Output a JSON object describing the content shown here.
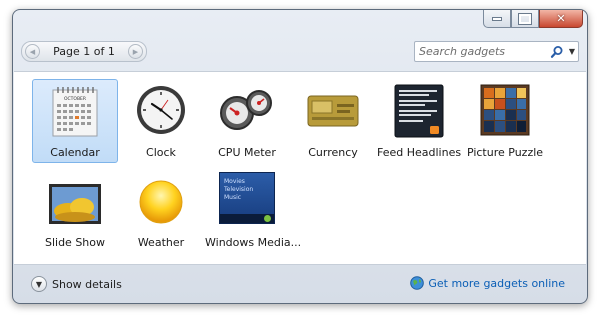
{
  "pager": {
    "label": "Page 1 of 1",
    "prev_icon": "triangle-left",
    "next_icon": "triangle-right"
  },
  "search": {
    "placeholder": "Search gadgets",
    "value": "",
    "icon": "magnifier",
    "dropdown_icon": "triangle-down"
  },
  "calendar_month": "OCTOBER",
  "gadgets": [
    {
      "label": "Calendar",
      "icon": "calendar-icon",
      "selected": true
    },
    {
      "label": "Clock",
      "icon": "clock-icon",
      "selected": false
    },
    {
      "label": "CPU Meter",
      "icon": "cpu-meter-icon",
      "selected": false
    },
    {
      "label": "Currency",
      "icon": "currency-icon",
      "selected": false
    },
    {
      "label": "Feed Headlines",
      "icon": "feed-icon",
      "selected": false
    },
    {
      "label": "Picture Puzzle",
      "icon": "puzzle-icon",
      "selected": false
    },
    {
      "label": "Slide Show",
      "icon": "slideshow-icon",
      "selected": false
    },
    {
      "label": "Weather",
      "icon": "weather-sun-icon",
      "selected": false
    },
    {
      "label": "Windows Media...",
      "icon": "windows-media-icon",
      "selected": false
    }
  ],
  "media_menu": [
    "Movies",
    "Television",
    "Music"
  ],
  "footer": {
    "details_label": "Show details",
    "online_label": "Get more gadgets online"
  },
  "colors": {
    "selection": "#c1dcf7",
    "link": "#0b5fb6",
    "close_button": "#c8472f"
  }
}
